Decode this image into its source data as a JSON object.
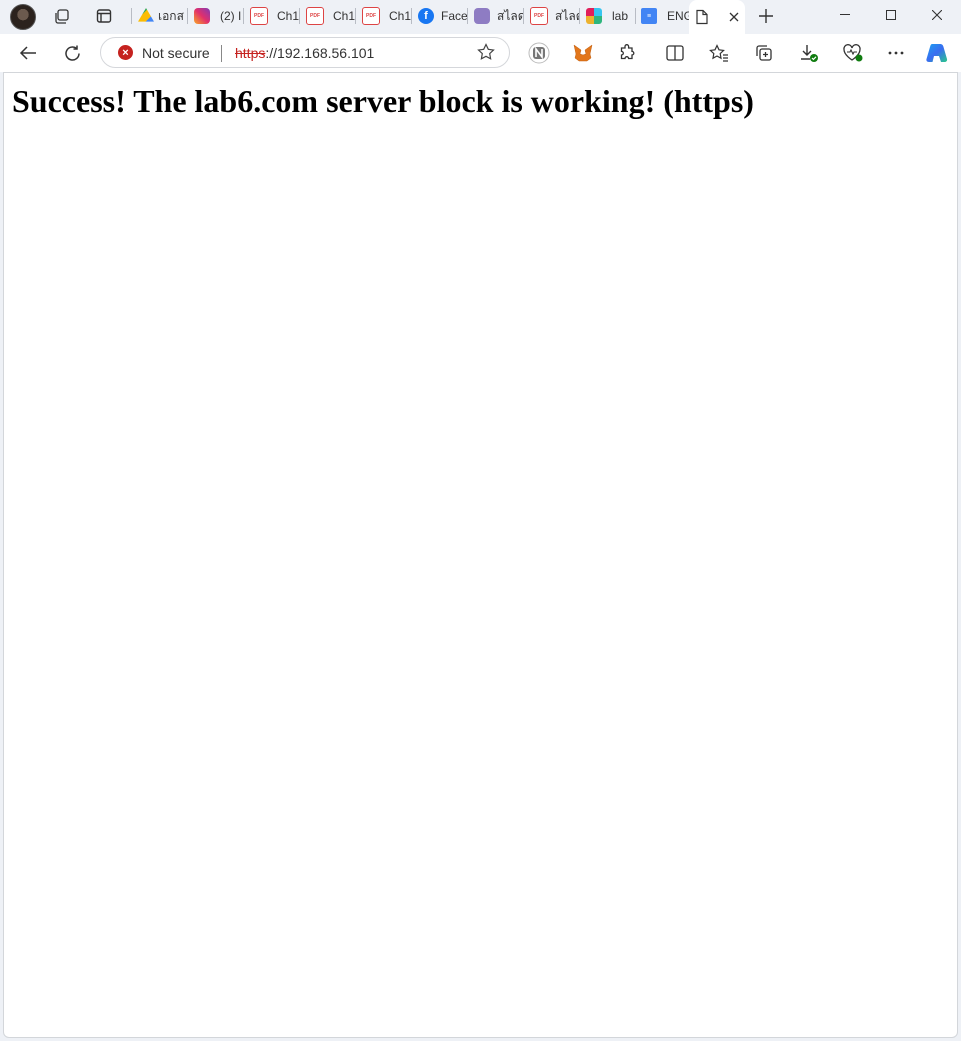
{
  "browser": {
    "tabs": [
      {
        "label": "เอกส",
        "icon": "google-drive-icon"
      },
      {
        "label": "(2) I",
        "icon": "instagram-icon"
      },
      {
        "label": "Ch1",
        "icon": "pdf-icon"
      },
      {
        "label": "Ch1",
        "icon": "pdf-icon"
      },
      {
        "label": "Ch1",
        "icon": "pdf-icon"
      },
      {
        "label": "Face",
        "icon": "facebook-icon"
      },
      {
        "label": "สไลด",
        "icon": "slides-icon"
      },
      {
        "label": "สไลด",
        "icon": "pdf-icon"
      },
      {
        "label": "lab",
        "icon": "slack-icon"
      },
      {
        "label": "ENG",
        "icon": "docs-icon"
      }
    ],
    "active_tab": {
      "label": "",
      "icon": "page-icon"
    },
    "address_bar": {
      "security_label": "Not secure",
      "url_scheme": "https",
      "url_rest": "://192.168.56.101"
    },
    "colors": {
      "insecure": "#c5221f",
      "tab_strip": "#eef1f6"
    }
  },
  "page": {
    "heading": "Success! The lab6.com server block is working! (https)"
  }
}
